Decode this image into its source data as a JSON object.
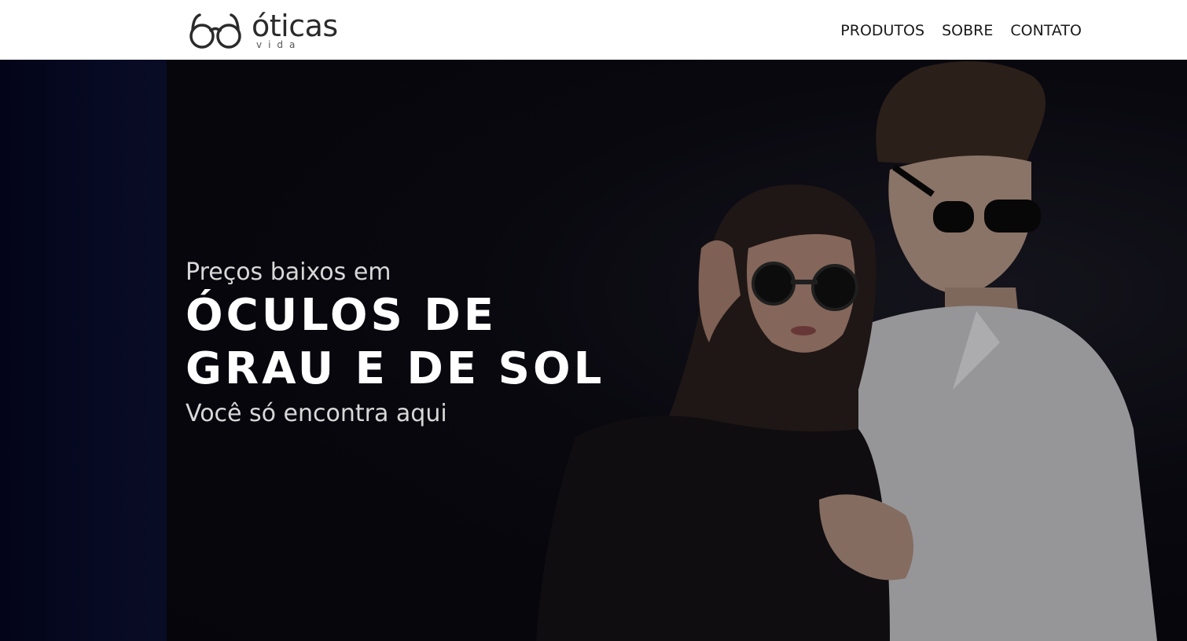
{
  "header": {
    "logo": {
      "word": "óticas",
      "sub": "vida",
      "icon": "glasses-icon"
    },
    "nav": [
      {
        "label": "PRODUTOS"
      },
      {
        "label": "SOBRE"
      },
      {
        "label": "CONTATO"
      }
    ]
  },
  "hero": {
    "kicker": "Preços baixos em",
    "headline_line1": "ÓCULOS DE",
    "headline_line2": "GRAU E DE SOL",
    "subline": "Você só encontra aqui",
    "image": "couple-wearing-sunglasses"
  },
  "colors": {
    "header_bg": "#ffffff",
    "hero_bg": "#06070f",
    "headline": "#ffffff",
    "nav_text": "#1a1a1a"
  }
}
